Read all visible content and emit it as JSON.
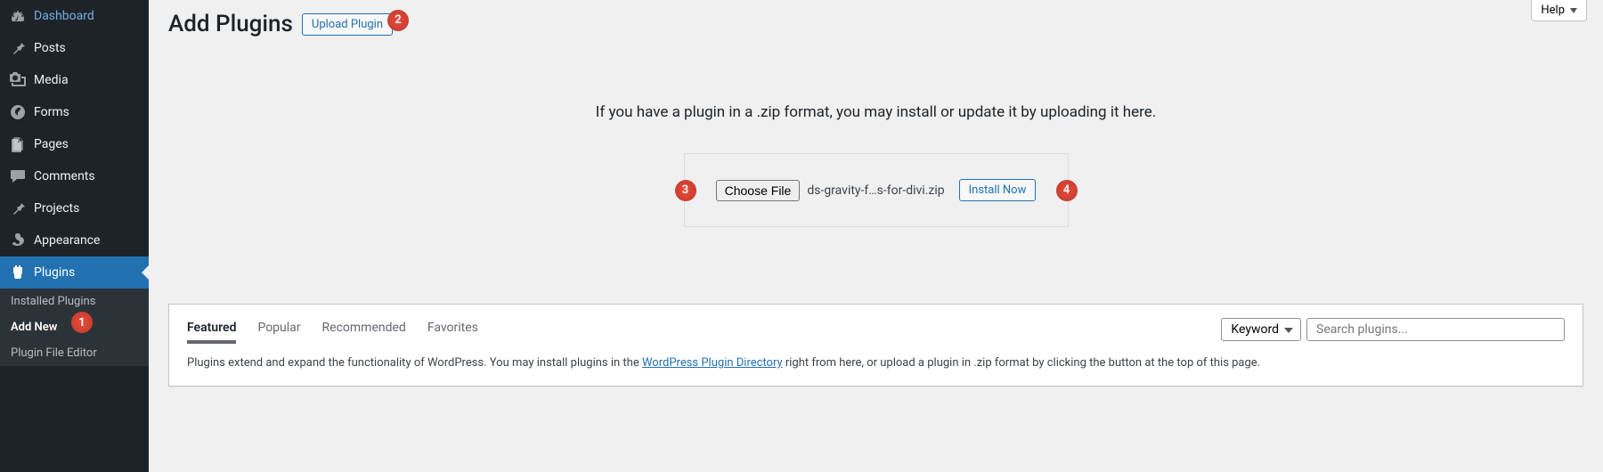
{
  "sidebar": {
    "items": [
      {
        "label": "Dashboard"
      },
      {
        "label": "Posts"
      },
      {
        "label": "Media"
      },
      {
        "label": "Forms"
      },
      {
        "label": "Pages"
      },
      {
        "label": "Comments"
      },
      {
        "label": "Projects"
      },
      {
        "label": "Appearance"
      },
      {
        "label": "Plugins"
      }
    ],
    "submenu": [
      {
        "label": "Installed Plugins"
      },
      {
        "label": "Add New"
      },
      {
        "label": "Plugin File Editor"
      }
    ]
  },
  "help_label": "Help",
  "header": {
    "title": "Add Plugins",
    "upload_label": "Upload Plugin"
  },
  "dropzone": {
    "text": "If you have a plugin in a .zip format, you may install or update it by uploading it here.",
    "choose_label": "Choose File",
    "file_name": "ds-gravity-f…s-for-divi.zip",
    "install_label": "Install Now"
  },
  "filters": {
    "tabs": [
      "Featured",
      "Popular",
      "Recommended",
      "Favorites"
    ],
    "keyword_label": "Keyword",
    "search_placeholder": "Search plugins..."
  },
  "blurb": {
    "pre": "Plugins extend and expand the functionality of WordPress. You may install plugins in the ",
    "link": "WordPress Plugin Directory",
    "post": " right from here, or upload a plugin in .zip format by clicking the button at the top of this page."
  },
  "badges": {
    "b1": "1",
    "b2": "2",
    "b3": "3",
    "b4": "4"
  }
}
